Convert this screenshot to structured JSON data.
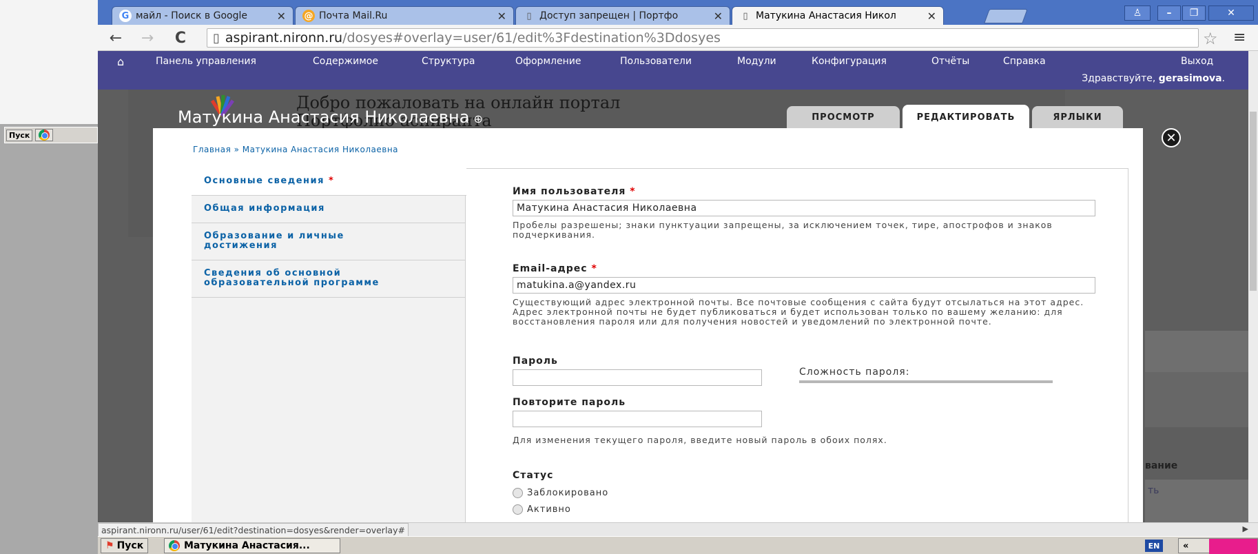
{
  "browser": {
    "tabs": [
      {
        "title": "майл - Поиск в Google",
        "icon": "google-icon"
      },
      {
        "title": "Почта Mail.Ru",
        "icon": "mail-ru-icon"
      },
      {
        "title": "Доступ запрещен | Портфо",
        "icon": "page-icon"
      },
      {
        "title": "Матукина Анастасия Никол",
        "icon": "page-icon"
      }
    ],
    "close_glyph": "✕",
    "address": {
      "host": "aspirant.nironn.ru",
      "path": "/dosyes#overlay=user/61/edit%3Fdestination%3Ddosyes"
    }
  },
  "admin_menu": {
    "items": [
      "Панель управления",
      "Содержимое",
      "Структура",
      "Оформление",
      "Пользователи",
      "Модули",
      "Конфигурация",
      "Отчёты",
      "Справка"
    ],
    "logout": "Выход",
    "greeting_prefix": "Здравствуйте, ",
    "username": "gerasimova",
    "greeting_suffix": "."
  },
  "background": {
    "site_title_line1": "Добро пожаловать на онлайн портал",
    "site_title_line2": "Портфолио аспиранта",
    "right_heading": "вание",
    "right_link": "ть"
  },
  "overlay": {
    "title": "Матукина Анастасия Николаевна",
    "title_plus": "⊕",
    "tabs": [
      "ПРОСМОТР",
      "РЕДАКТИРОВАТЬ",
      "ЯРЛЫКИ"
    ],
    "active_tab": "РЕДАКТИРОВАТЬ",
    "close_glyph": "✕",
    "breadcrumb": "Главная » Матукина Анастасия Николаевна"
  },
  "vertical_tabs": [
    {
      "label": "Основные сведения",
      "required": true
    },
    {
      "label": "Общая информация",
      "required": false
    },
    {
      "label": "Образование и личные достижения",
      "required": false
    },
    {
      "label": "Сведения об основной образовательной программе",
      "required": false
    }
  ],
  "form": {
    "username": {
      "label": "Имя пользователя",
      "value": "Матукина Анастасия Николаевна",
      "description": "Пробелы разрешены; знаки пунктуации запрещены, за исключением точек, тире, апострофов и знаков подчеркивания."
    },
    "email": {
      "label": "Email-адрес",
      "value": "matukina.a@yandex.ru",
      "description": "Существующий адрес электронной почты. Все почтовые сообщения с сайта будут отсылаться на этот адрес. Адрес электронной почты не будет публиковаться и будет использован только по вашему желанию: для восстановления пароля или для получения новостей и уведомлений по электронной почте."
    },
    "required_mark": "*",
    "password": {
      "label": "Пароль",
      "value": ""
    },
    "password_strength": "Сложность пароля:",
    "password_confirm": {
      "label": "Повторите пароль",
      "value": ""
    },
    "password_hint": "Для изменения текущего пароля, введите новый пароль в обоих полях.",
    "status": {
      "label": "Статус",
      "options": [
        "Заблокировано",
        "Активно"
      ]
    }
  },
  "statusbar": {
    "url": "aspirant.nironn.ru/user/61/edit?destination=dosyes&render=overlay#"
  },
  "taskbar": {
    "start": "Пуск",
    "task": "Матукина Анастасия...",
    "lang": "EN",
    "tray": "«"
  },
  "colors": {
    "admin_bar": "#47478f",
    "tab_strip": "#4b74c4",
    "link": "#0b62a6",
    "required": "#e00000"
  }
}
